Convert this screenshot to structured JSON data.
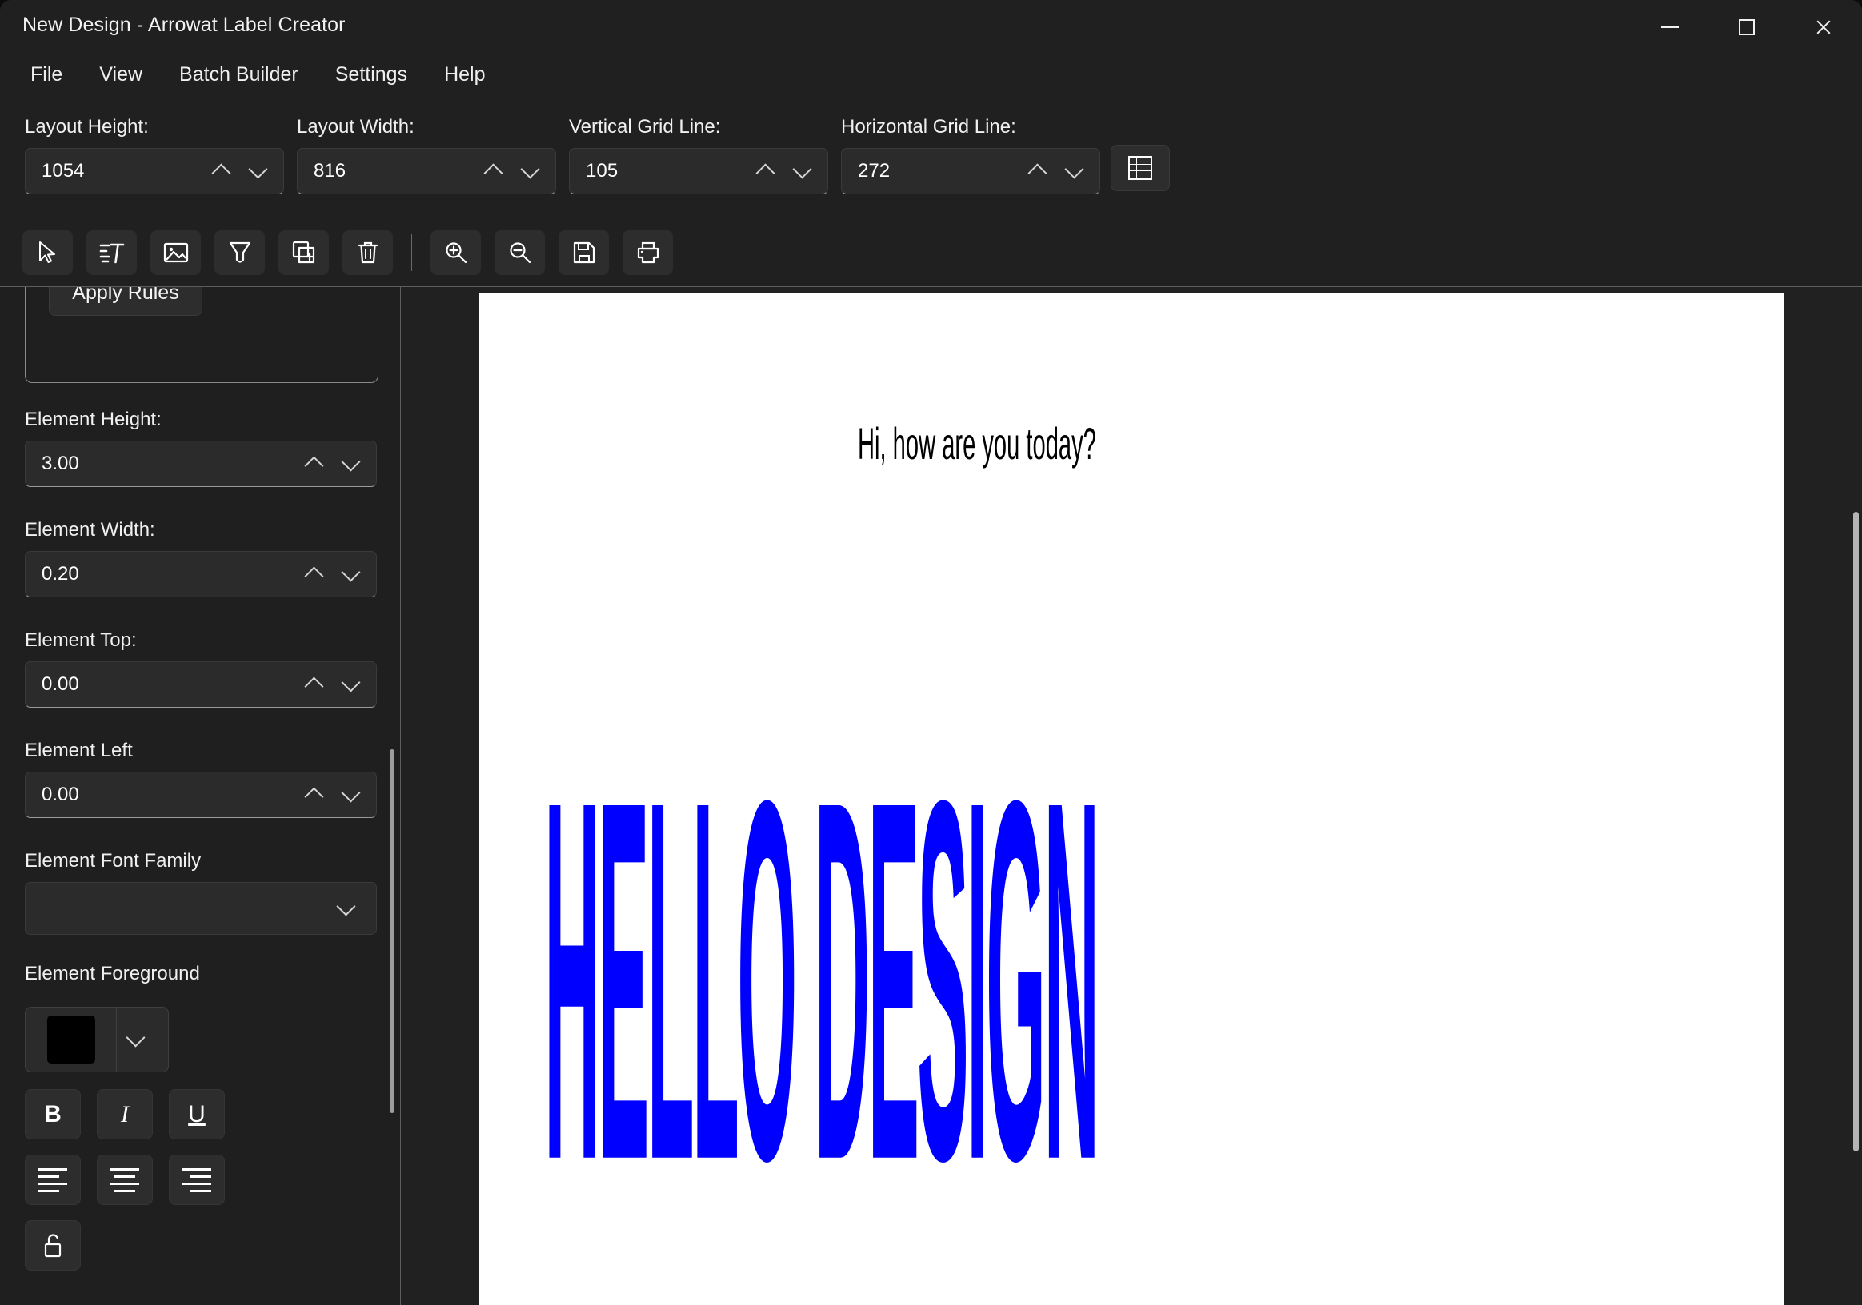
{
  "window": {
    "title": "New Design - Arrowat Label Creator",
    "controls": {
      "minimize": "minimize",
      "maximize": "maximize",
      "close": "close"
    }
  },
  "menu": {
    "items": [
      {
        "label": "File"
      },
      {
        "label": "View"
      },
      {
        "label": "Batch Builder"
      },
      {
        "label": "Settings"
      },
      {
        "label": "Help"
      }
    ]
  },
  "layout_toolbar": {
    "fields": [
      {
        "label": "Layout Height:",
        "value": "1054"
      },
      {
        "label": "Layout Width:",
        "value": "816"
      },
      {
        "label": "Vertical Grid Line:",
        "value": "105"
      },
      {
        "label": "Horizontal Grid Line:",
        "value": "272"
      }
    ],
    "grid_toggle": "grid-icon"
  },
  "tools": [
    {
      "name": "select-cursor-icon"
    },
    {
      "name": "text-element-icon"
    },
    {
      "name": "image-element-icon"
    },
    {
      "name": "shape-element-icon"
    },
    {
      "name": "duplicate-element-icon"
    },
    {
      "name": "delete-element-icon"
    },
    {
      "name": "zoom-in-icon"
    },
    {
      "name": "zoom-out-icon"
    },
    {
      "name": "save-icon"
    },
    {
      "name": "print-icon"
    }
  ],
  "sidebar": {
    "rules": {
      "input_value": "",
      "apply_label": "Apply Rules"
    },
    "fields": [
      {
        "label": "Element Height:",
        "value": "3.00"
      },
      {
        "label": "Element Width:",
        "value": "0.20"
      },
      {
        "label": "Element Top:",
        "value": "0.00"
      },
      {
        "label": "Element Left",
        "value": "0.00"
      }
    ],
    "font_family": {
      "label": "Element Font Family",
      "value": ""
    },
    "foreground": {
      "label": "Element Foreground",
      "color": "#000000"
    },
    "style_buttons": [
      {
        "name": "bold-button",
        "label": "B"
      },
      {
        "name": "italic-button",
        "label": "I"
      },
      {
        "name": "underline-button",
        "label": "U"
      }
    ],
    "align_buttons": [
      {
        "name": "align-left-button"
      },
      {
        "name": "align-center-button"
      },
      {
        "name": "align-right-button"
      }
    ],
    "lock_button": {
      "name": "lock-open-button"
    }
  },
  "canvas": {
    "elements": [
      {
        "name": "subtitle-text",
        "text": "Hi, how are you today?",
        "color": "#000000"
      },
      {
        "name": "headline-text",
        "text": "HELLO DESIGN",
        "color": "#0000ff"
      }
    ],
    "page_background": "#ffffff"
  }
}
